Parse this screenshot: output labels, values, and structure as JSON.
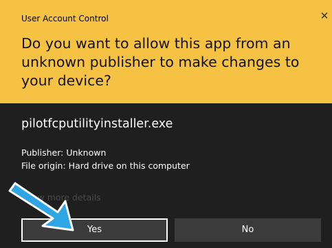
{
  "dialog": {
    "title": "User Account Control",
    "close_glyph": "✕",
    "question": "Do you want to allow this app from an unknown publisher to make changes to your device?",
    "app_name": "pilotfcputilityinstaller.exe",
    "publisher": "Publisher: Unknown",
    "file_origin": "File origin: Hard drive on this computer",
    "more_details": "Show more details",
    "yes_label": "Yes",
    "no_label": "No"
  },
  "colors": {
    "header_bg": "#f6c244",
    "body_bg": "#1f1f1f",
    "button_bg": "#3b3b3b",
    "arrow": "#2ea6e6"
  }
}
